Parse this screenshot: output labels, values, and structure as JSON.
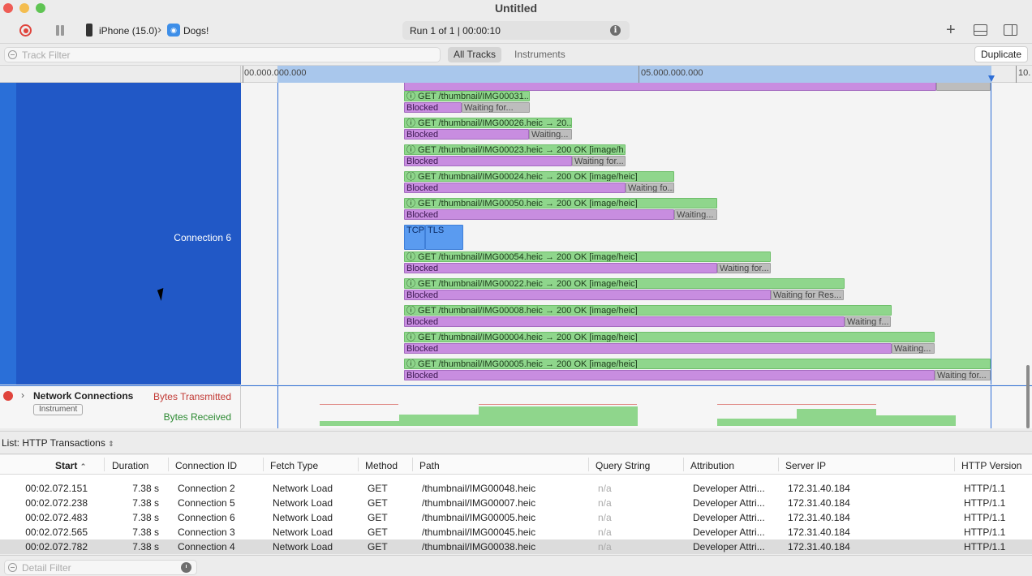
{
  "window": {
    "title": "Untitled"
  },
  "toolbar": {
    "device": "iPhone (15.0)",
    "app": "Dogs!",
    "run_status": "Run 1 of 1  |  00:00:10"
  },
  "filter": {
    "track_filter_placeholder": "Track Filter",
    "all_tracks": "All Tracks",
    "instruments": "Instruments",
    "duplicate": "Duplicate"
  },
  "ruler": {
    "start": "00.000.000.000",
    "mid": "05.000.000.000",
    "end": "10."
  },
  "track": {
    "connection_label": "Connection 6"
  },
  "timeline_rows": [
    {
      "label": "GET /thumbnail/IMG00031....",
      "blocked": "Blocked",
      "waiting": "Waiting for..."
    },
    {
      "label": "GET /thumbnail/IMG00026.heic → 20...",
      "blocked": "Blocked",
      "waiting": "Waiting..."
    },
    {
      "label": "GET /thumbnail/IMG00023.heic → 200 OK [image/h...",
      "blocked": "Blocked",
      "waiting": "Waiting for..."
    },
    {
      "label": "GET /thumbnail/IMG00024.heic → 200 OK [image/heic]",
      "blocked": "Blocked",
      "waiting": "Waiting fo..."
    },
    {
      "label": "GET /thumbnail/IMG00050.heic → 200 OK [image/heic]",
      "blocked": "Blocked",
      "waiting": "Waiting..."
    },
    {
      "label": "GET /thumbnail/IMG00054.heic → 200 OK [image/heic]",
      "blocked": "Blocked",
      "waiting": "Waiting for..."
    },
    {
      "label": "GET /thumbnail/IMG00022.heic → 200 OK [image/heic]",
      "blocked": "Blocked",
      "waiting": "Waiting for Res..."
    },
    {
      "label": "GET /thumbnail/IMG00008.heic → 200 OK [image/heic]",
      "blocked": "Blocked",
      "waiting": "Waiting f..."
    },
    {
      "label": "GET /thumbnail/IMG00004.heic → 200 OK [image/heic]",
      "blocked": "Blocked",
      "waiting": "Waiting..."
    },
    {
      "label": "GET /thumbnail/IMG00005.heic → 200 OK [image/heic]",
      "blocked": "Blocked",
      "waiting": "Waiting for..."
    }
  ],
  "tcp_tls": {
    "tcp": "TCP",
    "tls": "TLS"
  },
  "network": {
    "title": "Network Connections",
    "badge": "Instrument",
    "bytes_tx": "Bytes Transmitted",
    "bytes_rx": "Bytes Received"
  },
  "list": {
    "title": "List: HTTP Transactions"
  },
  "columns": [
    "Start",
    "Duration",
    "Connection ID",
    "Fetch Type",
    "Method",
    "Path",
    "Query String",
    "Attribution",
    "Server IP",
    "HTTP Version"
  ],
  "rows": [
    [
      "00:02.072.151",
      "7.38 s",
      "Connection 2",
      "Network Load",
      "GET",
      "/thumbnail/IMG00048.heic",
      "n/a",
      "Developer Attri...",
      "172.31.40.184",
      "HTTP/1.1"
    ],
    [
      "00:02.072.238",
      "7.38 s",
      "Connection 5",
      "Network Load",
      "GET",
      "/thumbnail/IMG00007.heic",
      "n/a",
      "Developer Attri...",
      "172.31.40.184",
      "HTTP/1.1"
    ],
    [
      "00:02.072.483",
      "7.38 s",
      "Connection 6",
      "Network Load",
      "GET",
      "/thumbnail/IMG00005.heic",
      "n/a",
      "Developer Attri...",
      "172.31.40.184",
      "HTTP/1.1"
    ],
    [
      "00:02.072.565",
      "7.38 s",
      "Connection 3",
      "Network Load",
      "GET",
      "/thumbnail/IMG00045.heic",
      "n/a",
      "Developer Attri...",
      "172.31.40.184",
      "HTTP/1.1"
    ],
    [
      "00:02.072.782",
      "7.38 s",
      "Connection 4",
      "Network Load",
      "GET",
      "/thumbnail/IMG00038.heic",
      "n/a",
      "Developer Attri...",
      "172.31.40.184",
      "HTTP/1.1"
    ]
  ],
  "bottom": {
    "detail_filter_placeholder": "Detail Filter"
  },
  "colors": {
    "accent": "#2158c6",
    "request": "#8fd68c",
    "blocked": "#c88de0",
    "waiting": "#bdbdbd"
  }
}
